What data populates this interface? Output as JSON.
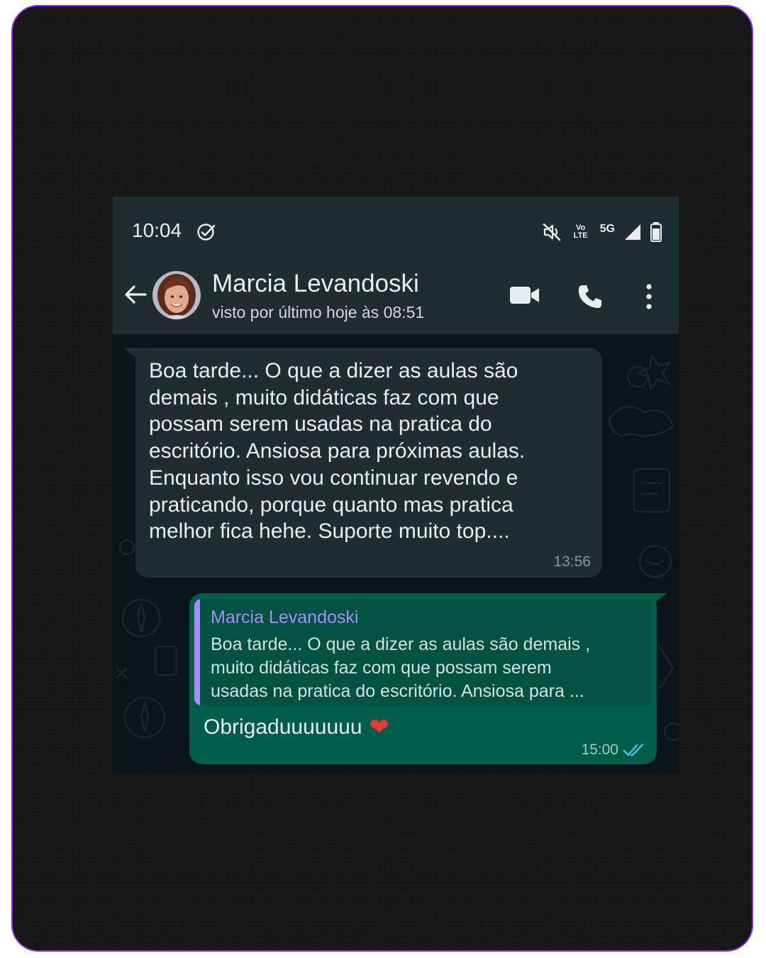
{
  "status_bar": {
    "time": "10:04",
    "volte_label": "Vo LTE",
    "network_label": "5G"
  },
  "header": {
    "contact_name": "Marcia Levandoski",
    "last_seen": "visto por último hoje às 08:51"
  },
  "messages": [
    {
      "direction": "incoming",
      "text": "Boa tarde... O que  a dizer as aulas são\ndemais , muito didáticas faz com que\npossam serem usadas na pratica do\nescritório. Ansiosa para próximas aulas.\nEnquanto isso vou continuar revendo e\npraticando, porque quanto mas pratica\nmelhor fica hehe. Suporte muito top....",
      "time": "13:56"
    },
    {
      "direction": "outgoing",
      "quote_author": "Marcia Levandoski",
      "quote_text": "Boa tarde... O que  a dizer as aulas são demais ,\nmuito didáticas faz com que possam serem\nusadas na pratica do escritório. Ansiosa para ...",
      "text": "Obrigaduuuuuuu",
      "emoji": "❤",
      "time": "15:00",
      "status": "read-double-check-icon"
    }
  ],
  "colors": {
    "frame_border": "#8a2be2",
    "header_bg": "#1f2c34",
    "chat_bg": "#0b141a",
    "incoming_bubble": "#1f2c34",
    "outgoing_bubble": "#005c4b",
    "quote_accent": "#a78bfa",
    "read_ticks": "#53bdeb"
  }
}
